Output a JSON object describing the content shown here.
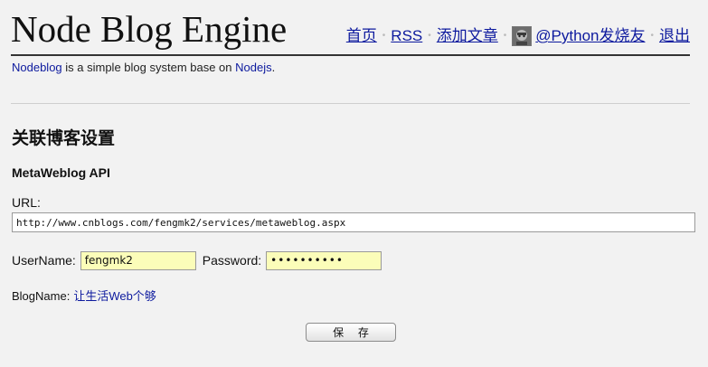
{
  "header": {
    "site_title": "Node Blog Engine",
    "nav": {
      "home": "首页",
      "rss": "RSS",
      "add_post": "添加文章",
      "user": "@Python发烧友",
      "logout": "退出",
      "separator": "•"
    }
  },
  "tagline": {
    "brand_link": "Nodeblog",
    "text": " is a simple blog system base on ",
    "tech_link": "Nodejs",
    "period": "."
  },
  "settings": {
    "section_title": "关联博客设置",
    "api_title": "MetaWeblog API",
    "url_label": "URL:",
    "url_value": "http://www.cnblogs.com/fengmk2/services/metaweblog.aspx",
    "username_label": "UserName:",
    "username_value": "fengmk2",
    "password_label": "Password:",
    "password_value": "••••••••••",
    "blogname_label": "BlogName:",
    "blogname_link": "让生活Web个够",
    "save_label": "保 存"
  },
  "colors": {
    "link": "#0d1a9e",
    "background": "#f2f2f2",
    "input_highlight": "#fbfdb9"
  }
}
